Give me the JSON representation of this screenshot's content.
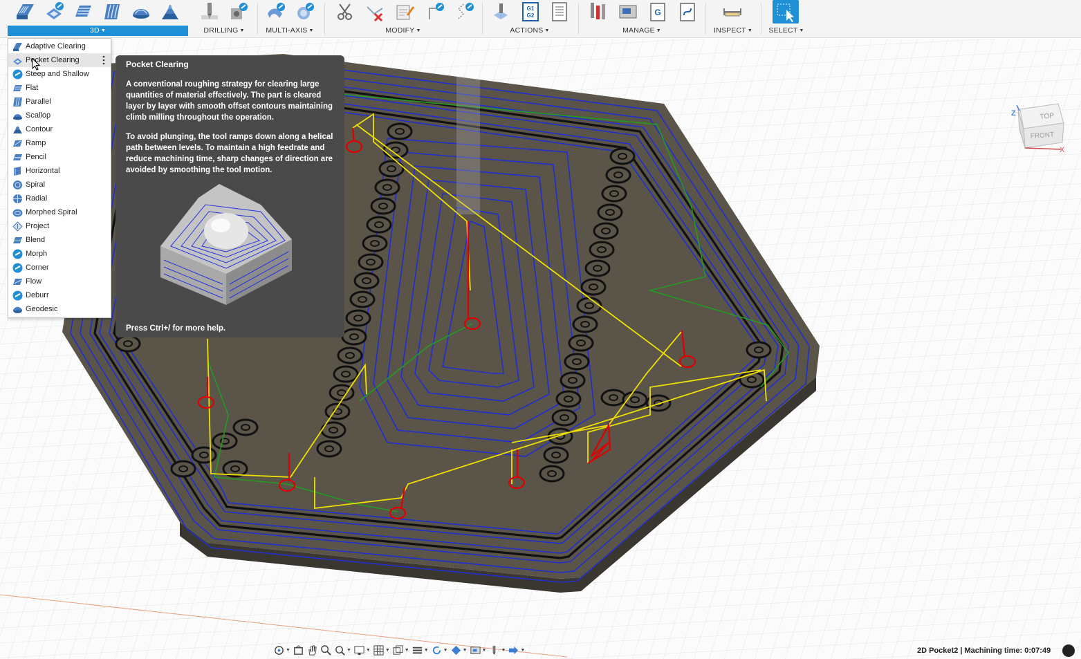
{
  "toolbar": {
    "groups": [
      {
        "label": "3D"
      },
      {
        "label": "DRILLING"
      },
      {
        "label": "MULTI-AXIS"
      },
      {
        "label": "MODIFY"
      },
      {
        "label": "ACTIONS"
      },
      {
        "label": "MANAGE"
      },
      {
        "label": "INSPECT"
      },
      {
        "label": "SELECT"
      }
    ],
    "actions_icon_text": "G1\nG2"
  },
  "menu": {
    "items": [
      {
        "label": "Adaptive Clearing",
        "icon": "adaptive-clearing-icon"
      },
      {
        "label": "Pocket Clearing",
        "icon": "pocket-clearing-icon",
        "active": true
      },
      {
        "label": "Steep and Shallow",
        "icon": "steep-shallow-icon"
      },
      {
        "label": "Flat",
        "icon": "flat-icon"
      },
      {
        "label": "Parallel",
        "icon": "parallel-icon"
      },
      {
        "label": "Scallop",
        "icon": "scallop-icon"
      },
      {
        "label": "Contour",
        "icon": "contour-icon"
      },
      {
        "label": "Ramp",
        "icon": "ramp-icon"
      },
      {
        "label": "Pencil",
        "icon": "pencil-icon"
      },
      {
        "label": "Horizontal",
        "icon": "horizontal-icon"
      },
      {
        "label": "Spiral",
        "icon": "spiral-icon"
      },
      {
        "label": "Radial",
        "icon": "radial-icon"
      },
      {
        "label": "Morphed Spiral",
        "icon": "morphed-spiral-icon"
      },
      {
        "label": "Project",
        "icon": "project-icon"
      },
      {
        "label": "Blend",
        "icon": "blend-icon"
      },
      {
        "label": "Morph",
        "icon": "morph-icon"
      },
      {
        "label": "Corner",
        "icon": "corner-icon"
      },
      {
        "label": "Flow",
        "icon": "flow-icon"
      },
      {
        "label": "Deburr",
        "icon": "deburr-icon"
      },
      {
        "label": "Geodesic",
        "icon": "geodesic-icon"
      }
    ]
  },
  "tooltip": {
    "title": "Pocket Clearing",
    "paragraph1": "A conventional roughing strategy for clearing large quantities of material effectively. The part is cleared layer by layer with smooth offset contours maintaining climb milling throughout the operation.",
    "paragraph2": "To avoid plunging, the tool ramps down along a helical path between levels. To maintain a high feedrate and reduce machining time, sharp changes of direction are avoided by smoothing the tool motion.",
    "help": "Press Ctrl+/ for more help."
  },
  "viewcube": {
    "top": "TOP",
    "front": "FRONT",
    "z": "Z",
    "x": "X"
  },
  "status": {
    "text": "2D Pocket2 | Machining time: 0:07:49"
  },
  "colors": {
    "accent": "#1f8fd6",
    "toolpath": "#1f2fd0",
    "lead": "#f0e000",
    "ramp": "#e00000",
    "link": "#20a020",
    "part": "#5a5449"
  }
}
